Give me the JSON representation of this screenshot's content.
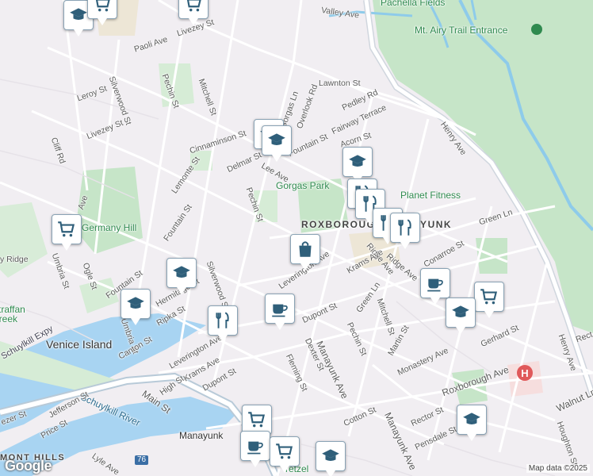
{
  "map": {
    "labels": {
      "pachella_fields": "Pachella Fields",
      "valley_ave": "Valley Ave",
      "mt_airy_trail": "Mt. Airy Trail Entrance",
      "paoli_ave": "Paoli Ave",
      "livezey_st_1": "Livezey St",
      "leroy_st": "Leroy St",
      "silverwood_st_1": "Silverwood St",
      "pechin_st_1": "Pechin St",
      "mitchell_st_1": "Mitchell St",
      "livezey_st_2": "Livezey St",
      "cliff_rd": "Cliff Rd",
      "cinnaminson_st": "Cinnaminson St",
      "lawnton_st": "Lawnton St",
      "overlook_rd": "Overlook Rd",
      "pedley_rd": "Pedley Rd",
      "fairway_terrace": "Fairway Terrace",
      "fountain_st_1": "Fountain St",
      "acorn_st": "Acorn St",
      "delmar_st": "Delmar St",
      "gorgas_ln": "Gorgas Ln",
      "lee_ave": "Lee Ave",
      "henry_ave_1": "Henry Ave",
      "lemonte_st": "Lemonte St",
      "gorgas_park": "Gorgas Park",
      "planet_fitness": "Planet Fitness",
      "pechin_st_2": "Pechin St",
      "roxborough_manayunk": "ROXBOROUGH-MANAYUNK",
      "green_ln_1": "Green Ln",
      "ave_fragment": "Ave",
      "fountain_st_2": "Fountain St",
      "germany_hill": "Germany Hill",
      "ridge_ave_1": "Ridge Ave",
      "rector_ridge": "y Ridge",
      "umbria_st_1": "Umbria St",
      "ogle_st": "Ogle St",
      "silverwood_st_2": "Silverwood St",
      "leverington_ave_1": "Leverington Ave",
      "krams_ave_1": "Krams Ave",
      "ridge_ave_2": "Ridge Ave",
      "conarroe_st": "Conarroe St",
      "fountain_st_3": "Fountain St",
      "hermitage_st": "Hermitage St",
      "green_ln_2": "Green Ln",
      "mitchell_st_2": "Mitchell St",
      "dupont_st_1": "Dupont St",
      "martin_st": "Martin St",
      "straffan_creek": "Straffan Creek",
      "ripka_st": "Ripka St",
      "umbria_st_2": "Umbria St",
      "venice_island": "Venice Island",
      "leverington_ave_2": "Leverington Ave",
      "pechin_st_3": "Pechin St",
      "dexter_st": "Dexter St",
      "martin_st_2": "Martin St",
      "monastery_ave": "Monastery Ave",
      "gerhard_st": "Gerhard St",
      "henry_ave_2": "Henry Ave",
      "canton_st": "Canton St",
      "schuylkill_expy": "Schuylkill Expy",
      "krams_ave_2": "Krams Ave",
      "dupont_st_2": "Dupont St",
      "fleming_st": "Fleming St",
      "manayunk_ave_1": "Manayunk Ave",
      "roxborough_ave": "Roxborough Ave",
      "high_st": "High St",
      "main_st": "Main St",
      "schuylkill_river": "Schuylkill River",
      "jefferson_st": "Jefferson St",
      "price_st": "Price St",
      "ezer_st": "ezer St",
      "cotton_st": "Cotton St",
      "rector_st": "Rector St",
      "walnut_ln": "Walnut Ln",
      "pensdale_st": "Pensdale St",
      "houghton_st": "Houghton St",
      "manayunk": "Manayunk",
      "manayunk_ave_2": "Manayunk Ave",
      "mont_hills": "MONT HILLS",
      "lyle_ave": "Lyle Ave",
      "route_76": "76",
      "pretzel": "retzel",
      "rect": "Rect",
      "martin_fragment": "rtin"
    },
    "pins": [
      {
        "icon": "school-icon"
      },
      {
        "icon": "cart-icon"
      },
      {
        "icon": "cart-icon"
      },
      {
        "icon": "school-icon"
      },
      {
        "icon": "school-icon"
      },
      {
        "icon": "school-icon"
      },
      {
        "icon": "restaurant-icon"
      },
      {
        "icon": "restaurant-icon"
      },
      {
        "icon": "cart-icon"
      },
      {
        "icon": "school-icon"
      },
      {
        "icon": "school-icon"
      },
      {
        "icon": "shopping-bag-icon"
      },
      {
        "icon": "cafe-icon"
      },
      {
        "icon": "restaurant-icon"
      },
      {
        "icon": "cafe-icon"
      },
      {
        "icon": "cart-icon"
      },
      {
        "icon": "school-icon"
      },
      {
        "icon": "school-icon"
      },
      {
        "icon": "cart-icon"
      },
      {
        "icon": "cafe-icon"
      },
      {
        "icon": "cart-icon"
      },
      {
        "icon": "school-icon"
      }
    ],
    "hospital_symbol": "H",
    "attribution": "Map data ©2025",
    "logo": "Google",
    "colors": {
      "background": "#f1eef2",
      "park": "#c8e6c9",
      "water": "#a8d4f2",
      "road": "#ffffff",
      "highway": "#a7c0d1",
      "pin_border": "#8aa3b5"
    }
  }
}
